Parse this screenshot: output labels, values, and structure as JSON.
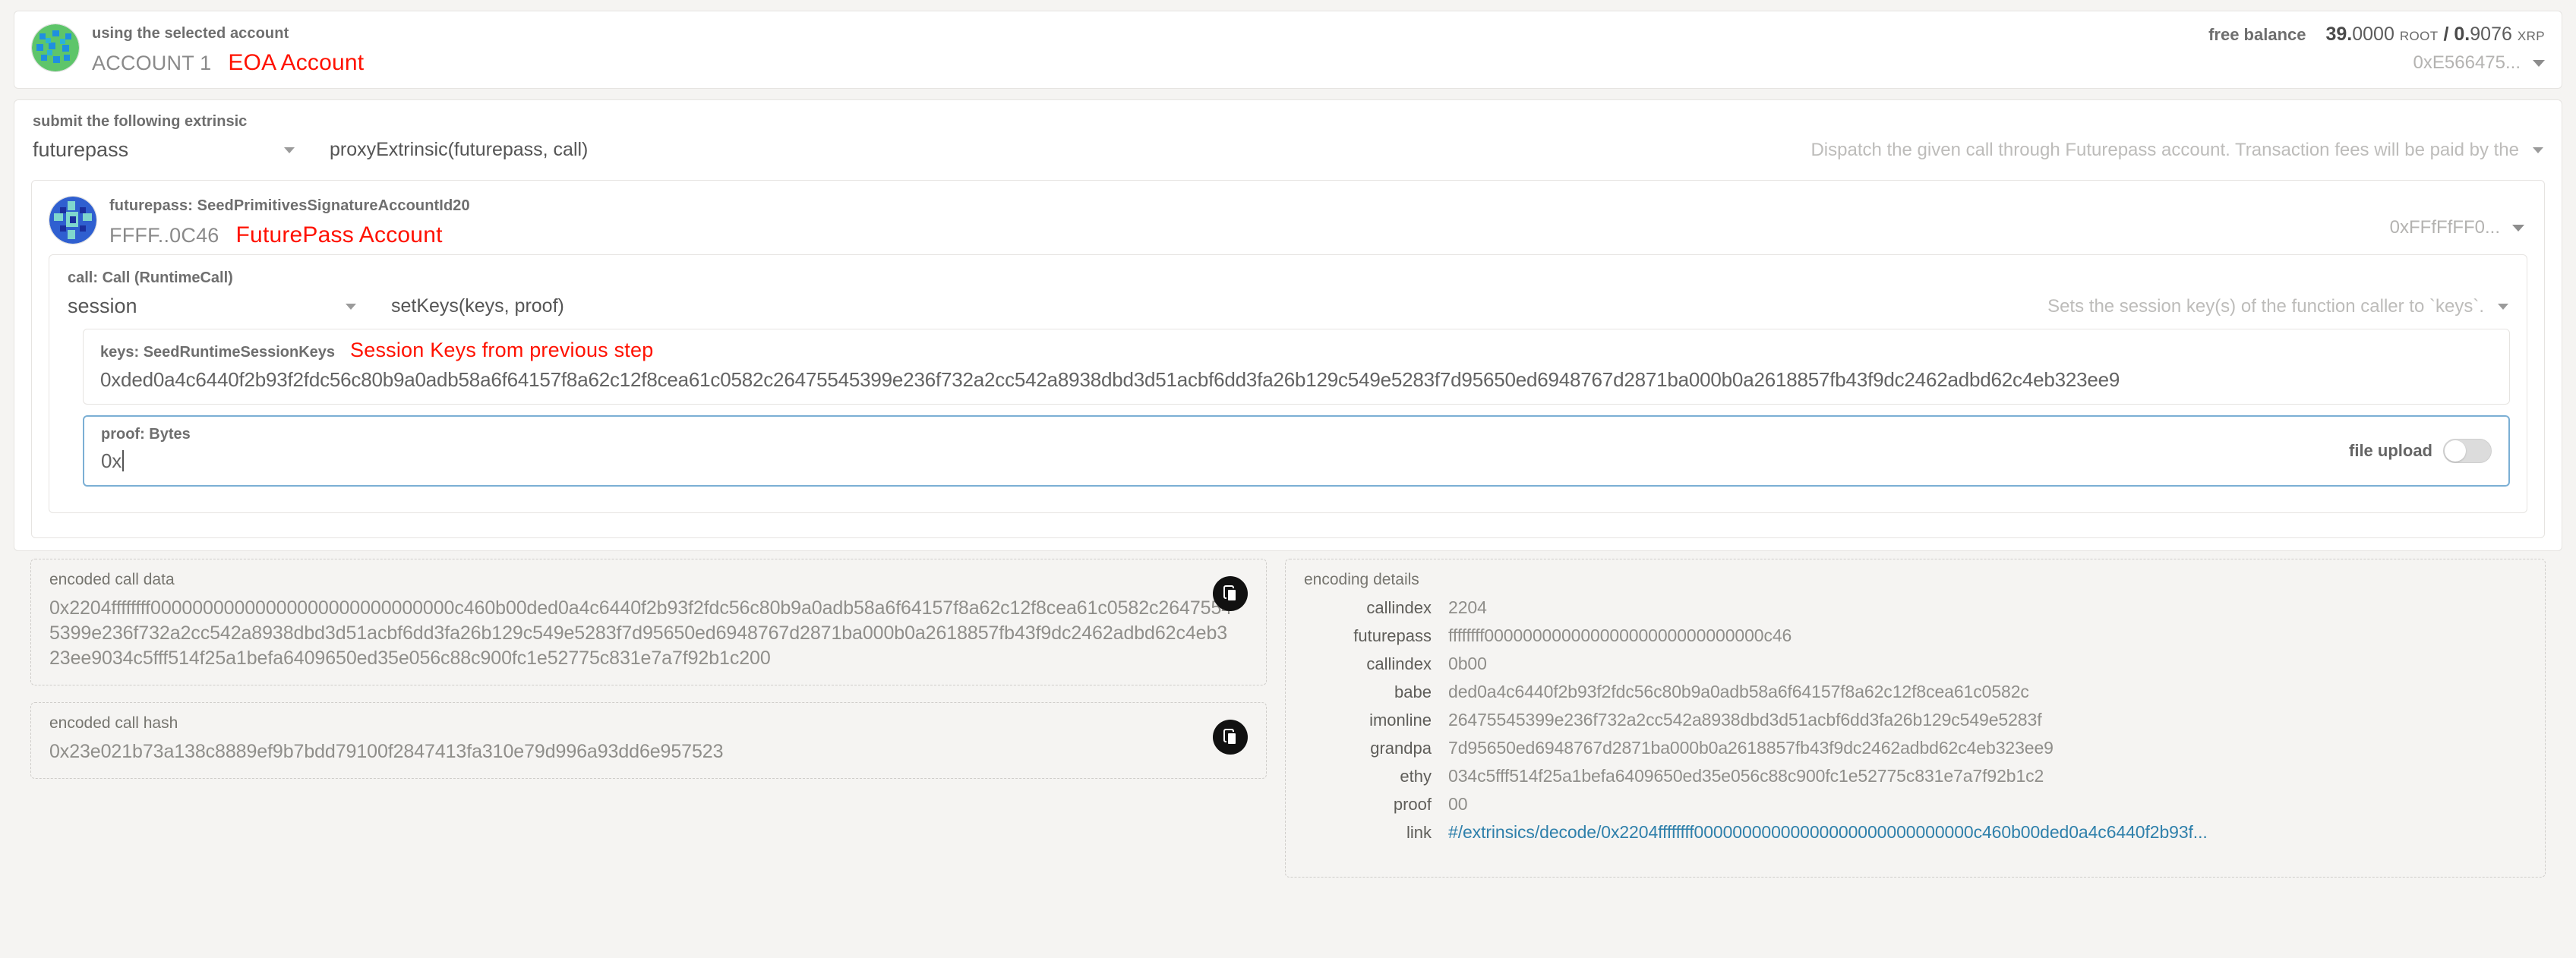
{
  "account": {
    "caption": "using the selected account",
    "name": "ACCOUNT 1",
    "annotation": "EOA Account",
    "balance_label": "free balance",
    "balance_root_num": "39.",
    "balance_root_dec": "0000",
    "balance_root_unit": "ROOT",
    "balance_sep": "/",
    "balance_xrp_num": "0.",
    "balance_xrp_dec": "9076",
    "balance_xrp_unit": "XRP",
    "address_short": "0xE566475...",
    "caret_icon": "chevron-down-icon"
  },
  "extrinsic": {
    "label": "submit the following extrinsic",
    "section": "futurepass",
    "method_sig": "proxyExtrinsic(futurepass, call)",
    "description": "Dispatch the given call through Futurepass account. Transaction fees will be paid by the"
  },
  "futurepass_account": {
    "caption": "futurepass: SeedPrimitivesSignatureAccountId20",
    "name": "FFFF..0C46",
    "annotation": "FuturePass Account",
    "address_short": "0xFFfFfFF0..."
  },
  "call": {
    "label": "call: Call (RuntimeCall)",
    "section": "session",
    "method_sig": "setKeys(keys, proof)",
    "description": "Sets the session key(s) of the function caller to `keys`."
  },
  "keys_param": {
    "label": "keys: SeedRuntimeSessionKeys",
    "annotation": "Session Keys from previous step",
    "value": "0xded0a4c6440f2b93f2fdc56c80b9a0adb58a6f64157f8a62c12f8cea61c0582c26475545399e236f732a2cc542a8938dbd3d51acbf6dd3fa26b129c549e5283f7d95650ed6948767d2871ba000b0a2618857fb43f9dc2462adbd62c4eb323ee9"
  },
  "proof_param": {
    "label": "proof: Bytes",
    "value": "0x",
    "file_upload_label": "file upload",
    "file_upload_state": "off"
  },
  "encoded_call_data": {
    "title": "encoded call data",
    "value": "0x2204ffffffff00000000000000000000000000000c460b00ded0a4c6440f2b93f2fdc56c80b9a0adb58a6f64157f8a62c12f8cea61c0582c26475545399e236f732a2cc542a8938dbd3d51acbf6dd3fa26b129c549e5283f7d95650ed6948767d2871ba000b0a2618857fb43f9dc2462adbd62c4eb323ee9034c5fff514f25a1befa6409650ed35e056c88c900fc1e52775c831e7a7f92b1c200",
    "copy_icon": "copy-icon"
  },
  "encoded_call_hash": {
    "title": "encoded call hash",
    "value": "0x23e021b73a138c8889ef9b7bdd79100f2847413fa310e79d996a93dd6e957523",
    "copy_icon": "copy-icon"
  },
  "encoding_details": {
    "title": "encoding details",
    "rows": [
      {
        "key": "callindex",
        "value": "2204",
        "is_link": false
      },
      {
        "key": "futurepass",
        "value": "ffffffff00000000000000000000000000000c46",
        "is_link": false
      },
      {
        "key": "callindex",
        "value": "0b00",
        "is_link": false
      },
      {
        "key": "babe",
        "value": "ded0a4c6440f2b93f2fdc56c80b9a0adb58a6f64157f8a62c12f8cea61c0582c",
        "is_link": false
      },
      {
        "key": "imonline",
        "value": "26475545399e236f732a2cc542a8938dbd3d51acbf6dd3fa26b129c549e5283f",
        "is_link": false
      },
      {
        "key": "grandpa",
        "value": "7d95650ed6948767d2871ba000b0a2618857fb43f9dc2462adbd62c4eb323ee9",
        "is_link": false
      },
      {
        "key": "ethy",
        "value": "034c5fff514f25a1befa6409650ed35e056c88c900fc1e52775c831e7a7f92b1c2",
        "is_link": false
      },
      {
        "key": "proof",
        "value": "00",
        "is_link": false
      },
      {
        "key": "link",
        "value": "#/extrinsics/decode/0x2204ffffffff00000000000000000000000000000c460b00ded0a4c6440f2b93f...",
        "is_link": true
      }
    ]
  },
  "colors": {
    "annotation_red": "#ff1100",
    "link_blue": "#2f80ab",
    "focus_border": "#7bafd4"
  }
}
